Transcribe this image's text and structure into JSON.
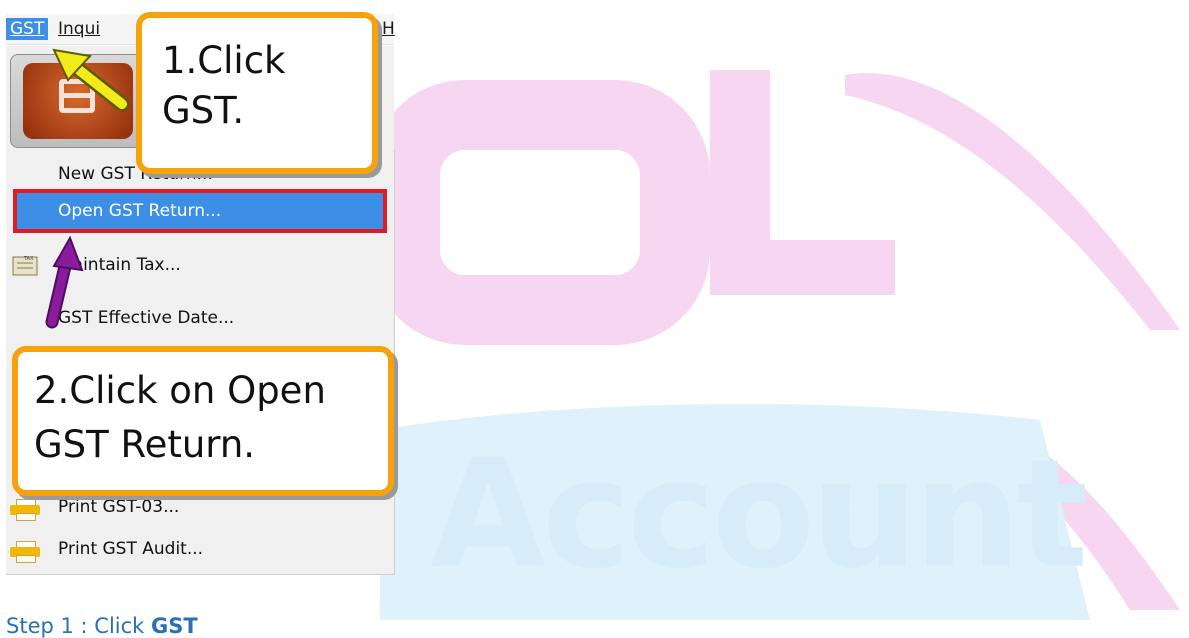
{
  "menubar": {
    "items": [
      {
        "label": "GST",
        "active": true
      },
      {
        "label": "Inqui",
        "active": false
      },
      {
        "label": "H",
        "active": false
      }
    ]
  },
  "toolbar": {
    "icon": "gst-module-icon"
  },
  "menu": {
    "items": [
      {
        "label": "New GST Return...",
        "icon": "none"
      },
      {
        "label": "Open GST Return...",
        "icon": "none",
        "selected": true
      },
      {
        "label": "Maintain Tax...",
        "icon": "tax-icon"
      },
      {
        "label": "GST Effective Date...",
        "icon": "none"
      },
      {
        "label": "Print GST-03...",
        "icon": "printer-icon"
      },
      {
        "label": "Print GST Audit...",
        "icon": "printer-icon"
      }
    ]
  },
  "callouts": {
    "step1": {
      "line1": "1.Click",
      "line2": "GST."
    },
    "step2": {
      "line1": "2.Click on Open",
      "line2": "GST Return."
    }
  },
  "watermark": {
    "text": "Account"
  },
  "caption": {
    "prefix": "Step 1 : Click ",
    "bold": "GST"
  },
  "colors": {
    "accent": "#f5a20c",
    "highlight": "#e21b23",
    "selection": "#3d8fe6",
    "caption": "#2b6fb4"
  }
}
